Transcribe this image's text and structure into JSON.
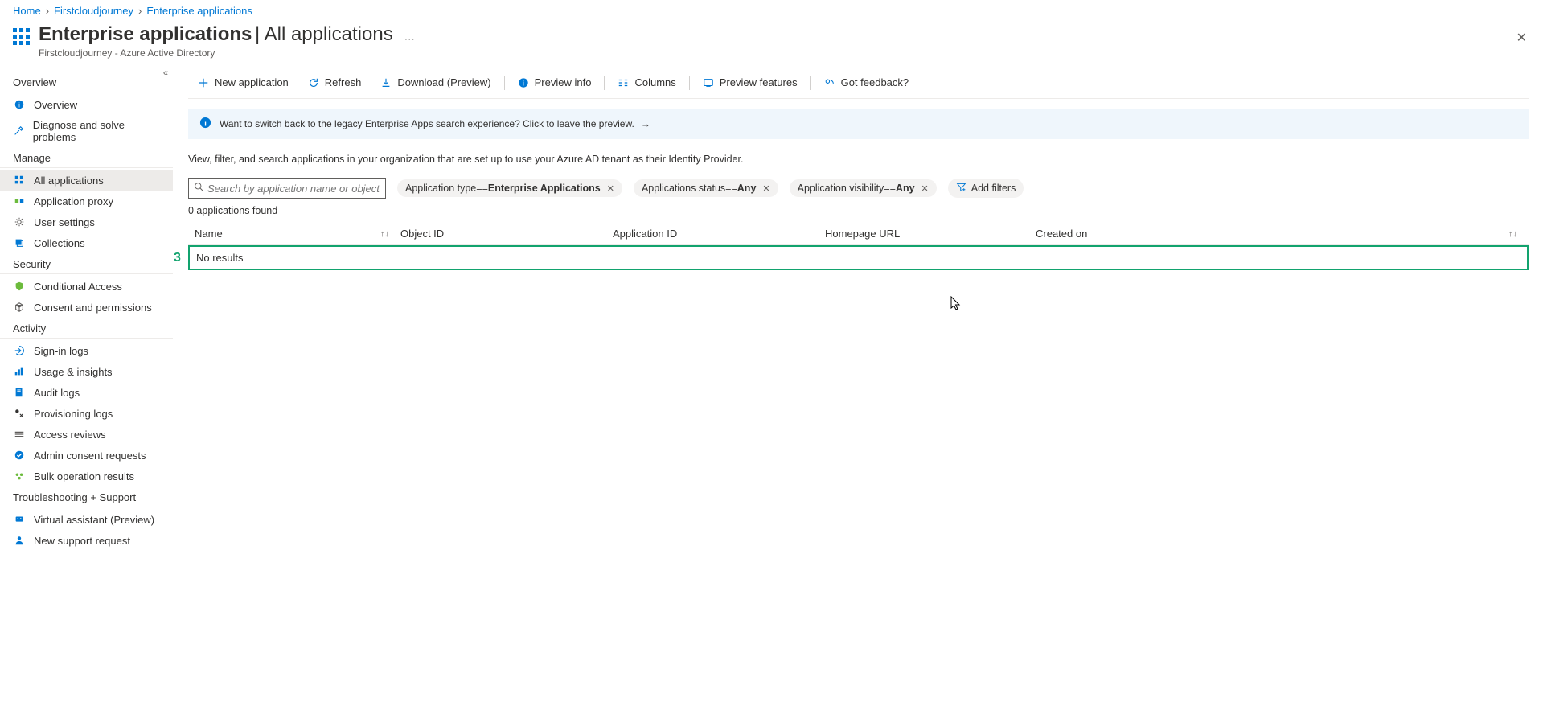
{
  "breadcrumb": [
    "Home",
    "Firstcloudjourney",
    "Enterprise applications"
  ],
  "header": {
    "title": "Enterprise applications",
    "subtitle": "All applications",
    "org": "Firstcloudjourney - Azure Active Directory"
  },
  "sidebar": {
    "sections": [
      {
        "title": "Overview",
        "items": [
          {
            "label": "Overview",
            "icon": "info-icon"
          },
          {
            "label": "Diagnose and solve problems",
            "icon": "wrench-icon"
          }
        ]
      },
      {
        "title": "Manage",
        "items": [
          {
            "label": "All applications",
            "icon": "apps-icon",
            "active": true
          },
          {
            "label": "Application proxy",
            "icon": "proxy-icon"
          },
          {
            "label": "User settings",
            "icon": "gear-icon"
          },
          {
            "label": "Collections",
            "icon": "collections-icon"
          }
        ]
      },
      {
        "title": "Security",
        "items": [
          {
            "label": "Conditional Access",
            "icon": "shield-icon"
          },
          {
            "label": "Consent and permissions",
            "icon": "cube-icon"
          }
        ]
      },
      {
        "title": "Activity",
        "items": [
          {
            "label": "Sign-in logs",
            "icon": "signin-icon"
          },
          {
            "label": "Usage & insights",
            "icon": "chart-icon"
          },
          {
            "label": "Audit logs",
            "icon": "book-icon"
          },
          {
            "label": "Provisioning logs",
            "icon": "prov-icon"
          },
          {
            "label": "Access reviews",
            "icon": "access-icon"
          },
          {
            "label": "Admin consent requests",
            "icon": "admin-icon"
          },
          {
            "label": "Bulk operation results",
            "icon": "bulk-icon"
          }
        ]
      },
      {
        "title": "Troubleshooting + Support",
        "items": [
          {
            "label": "Virtual assistant (Preview)",
            "icon": "assistant-icon"
          },
          {
            "label": "New support request",
            "icon": "support-icon"
          }
        ]
      }
    ]
  },
  "toolbar": {
    "new_app": "New application",
    "refresh": "Refresh",
    "download": "Download (Preview)",
    "preview_info": "Preview info",
    "columns": "Columns",
    "preview_features": "Preview features",
    "feedback": "Got feedback?"
  },
  "banner": {
    "text": "Want to switch back to the legacy Enterprise Apps search experience? Click to leave the preview."
  },
  "description": "View, filter, and search applications in your organization that are set up to use your Azure AD tenant as their Identity Provider.",
  "search": {
    "placeholder": "Search by application name or object ID"
  },
  "filters": {
    "type_label": "Application type ",
    "type_op": "== ",
    "type_val": "Enterprise Applications",
    "status_label": "Applications status ",
    "status_op": "== ",
    "status_val": "Any",
    "visibility_label": "Application visibility ",
    "visibility_op": "== ",
    "visibility_val": "Any",
    "add": "Add filters"
  },
  "count": "0 applications found",
  "columns": {
    "name": "Name",
    "object_id": "Object ID",
    "application_id": "Application ID",
    "homepage": "Homepage URL",
    "created": "Created on"
  },
  "no_results": "No results",
  "annotation": "3"
}
